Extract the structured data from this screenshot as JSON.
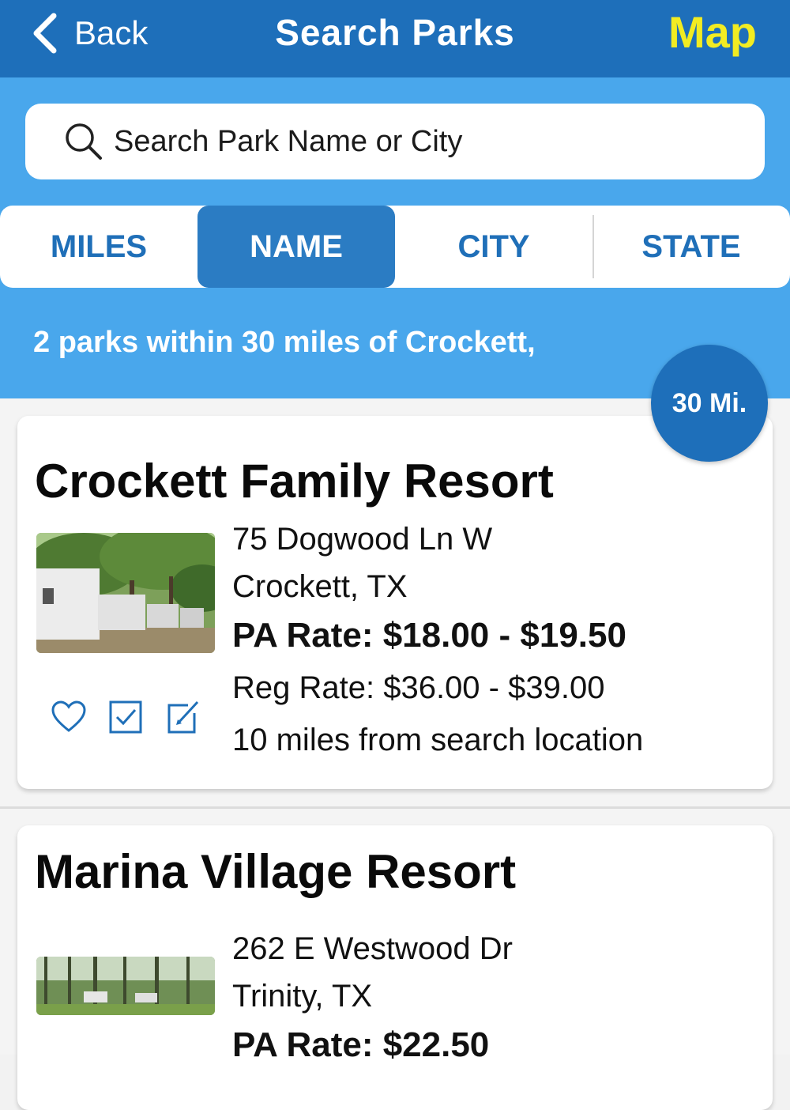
{
  "nav": {
    "back_label": "Back",
    "title": "Search Parks",
    "map_label": "Map"
  },
  "search": {
    "placeholder": "Search Park Name or City",
    "value": ""
  },
  "tabs": [
    {
      "label": "MILES",
      "active": false
    },
    {
      "label": "NAME",
      "active": true
    },
    {
      "label": "CITY",
      "active": false
    },
    {
      "label": "STATE",
      "active": false
    }
  ],
  "results": {
    "summary": "2 parks within 30 miles of Crockett,",
    "radius_badge": "30 Mi."
  },
  "parks": [
    {
      "name": "Crockett Family Resort",
      "address": "75 Dogwood Ln W",
      "city": "Crockett, TX",
      "pa_rate": "PA Rate: $18.00 - $19.50",
      "reg_rate": "Reg Rate: $36.00 - $39.00",
      "distance": "10 miles from search location",
      "icons": [
        "heart-icon",
        "checkbox-icon",
        "edit-icon"
      ]
    },
    {
      "name": "Marina Village Resort",
      "address": "262 E Westwood Dr",
      "city": "Trinity, TX",
      "pa_rate": "PA Rate: $22.50"
    }
  ],
  "colors": {
    "nav_bg": "#1e6fba",
    "band_bg": "#49a7ec",
    "tab_text": "#1f6fb8",
    "active_tab": "#2b7cc3",
    "map_yellow": "#f2ec22"
  }
}
